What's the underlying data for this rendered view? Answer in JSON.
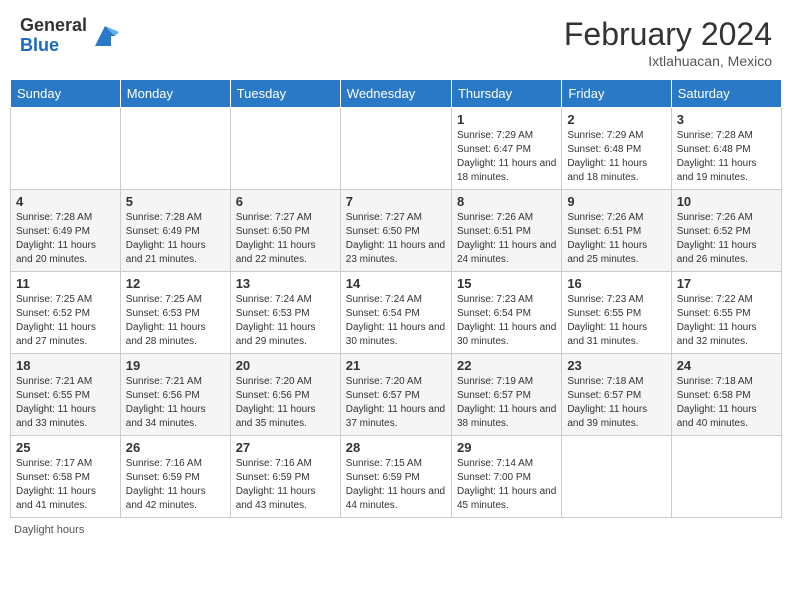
{
  "header": {
    "logo_general": "General",
    "logo_blue": "Blue",
    "month_title": "February 2024",
    "location": "Ixtlahuacan, Mexico"
  },
  "days_of_week": [
    "Sunday",
    "Monday",
    "Tuesday",
    "Wednesday",
    "Thursday",
    "Friday",
    "Saturday"
  ],
  "weeks": [
    [
      {
        "day": "",
        "info": ""
      },
      {
        "day": "",
        "info": ""
      },
      {
        "day": "",
        "info": ""
      },
      {
        "day": "",
        "info": ""
      },
      {
        "day": "1",
        "info": "Sunrise: 7:29 AM\nSunset: 6:47 PM\nDaylight: 11 hours and 18 minutes."
      },
      {
        "day": "2",
        "info": "Sunrise: 7:29 AM\nSunset: 6:48 PM\nDaylight: 11 hours and 18 minutes."
      },
      {
        "day": "3",
        "info": "Sunrise: 7:28 AM\nSunset: 6:48 PM\nDaylight: 11 hours and 19 minutes."
      }
    ],
    [
      {
        "day": "4",
        "info": "Sunrise: 7:28 AM\nSunset: 6:49 PM\nDaylight: 11 hours and 20 minutes."
      },
      {
        "day": "5",
        "info": "Sunrise: 7:28 AM\nSunset: 6:49 PM\nDaylight: 11 hours and 21 minutes."
      },
      {
        "day": "6",
        "info": "Sunrise: 7:27 AM\nSunset: 6:50 PM\nDaylight: 11 hours and 22 minutes."
      },
      {
        "day": "7",
        "info": "Sunrise: 7:27 AM\nSunset: 6:50 PM\nDaylight: 11 hours and 23 minutes."
      },
      {
        "day": "8",
        "info": "Sunrise: 7:26 AM\nSunset: 6:51 PM\nDaylight: 11 hours and 24 minutes."
      },
      {
        "day": "9",
        "info": "Sunrise: 7:26 AM\nSunset: 6:51 PM\nDaylight: 11 hours and 25 minutes."
      },
      {
        "day": "10",
        "info": "Sunrise: 7:26 AM\nSunset: 6:52 PM\nDaylight: 11 hours and 26 minutes."
      }
    ],
    [
      {
        "day": "11",
        "info": "Sunrise: 7:25 AM\nSunset: 6:52 PM\nDaylight: 11 hours and 27 minutes."
      },
      {
        "day": "12",
        "info": "Sunrise: 7:25 AM\nSunset: 6:53 PM\nDaylight: 11 hours and 28 minutes."
      },
      {
        "day": "13",
        "info": "Sunrise: 7:24 AM\nSunset: 6:53 PM\nDaylight: 11 hours and 29 minutes."
      },
      {
        "day": "14",
        "info": "Sunrise: 7:24 AM\nSunset: 6:54 PM\nDaylight: 11 hours and 30 minutes."
      },
      {
        "day": "15",
        "info": "Sunrise: 7:23 AM\nSunset: 6:54 PM\nDaylight: 11 hours and 30 minutes."
      },
      {
        "day": "16",
        "info": "Sunrise: 7:23 AM\nSunset: 6:55 PM\nDaylight: 11 hours and 31 minutes."
      },
      {
        "day": "17",
        "info": "Sunrise: 7:22 AM\nSunset: 6:55 PM\nDaylight: 11 hours and 32 minutes."
      }
    ],
    [
      {
        "day": "18",
        "info": "Sunrise: 7:21 AM\nSunset: 6:55 PM\nDaylight: 11 hours and 33 minutes."
      },
      {
        "day": "19",
        "info": "Sunrise: 7:21 AM\nSunset: 6:56 PM\nDaylight: 11 hours and 34 minutes."
      },
      {
        "day": "20",
        "info": "Sunrise: 7:20 AM\nSunset: 6:56 PM\nDaylight: 11 hours and 35 minutes."
      },
      {
        "day": "21",
        "info": "Sunrise: 7:20 AM\nSunset: 6:57 PM\nDaylight: 11 hours and 37 minutes."
      },
      {
        "day": "22",
        "info": "Sunrise: 7:19 AM\nSunset: 6:57 PM\nDaylight: 11 hours and 38 minutes."
      },
      {
        "day": "23",
        "info": "Sunrise: 7:18 AM\nSunset: 6:57 PM\nDaylight: 11 hours and 39 minutes."
      },
      {
        "day": "24",
        "info": "Sunrise: 7:18 AM\nSunset: 6:58 PM\nDaylight: 11 hours and 40 minutes."
      }
    ],
    [
      {
        "day": "25",
        "info": "Sunrise: 7:17 AM\nSunset: 6:58 PM\nDaylight: 11 hours and 41 minutes."
      },
      {
        "day": "26",
        "info": "Sunrise: 7:16 AM\nSunset: 6:59 PM\nDaylight: 11 hours and 42 minutes."
      },
      {
        "day": "27",
        "info": "Sunrise: 7:16 AM\nSunset: 6:59 PM\nDaylight: 11 hours and 43 minutes."
      },
      {
        "day": "28",
        "info": "Sunrise: 7:15 AM\nSunset: 6:59 PM\nDaylight: 11 hours and 44 minutes."
      },
      {
        "day": "29",
        "info": "Sunrise: 7:14 AM\nSunset: 7:00 PM\nDaylight: 11 hours and 45 minutes."
      },
      {
        "day": "",
        "info": ""
      },
      {
        "day": "",
        "info": ""
      }
    ]
  ],
  "footer": "Daylight hours"
}
